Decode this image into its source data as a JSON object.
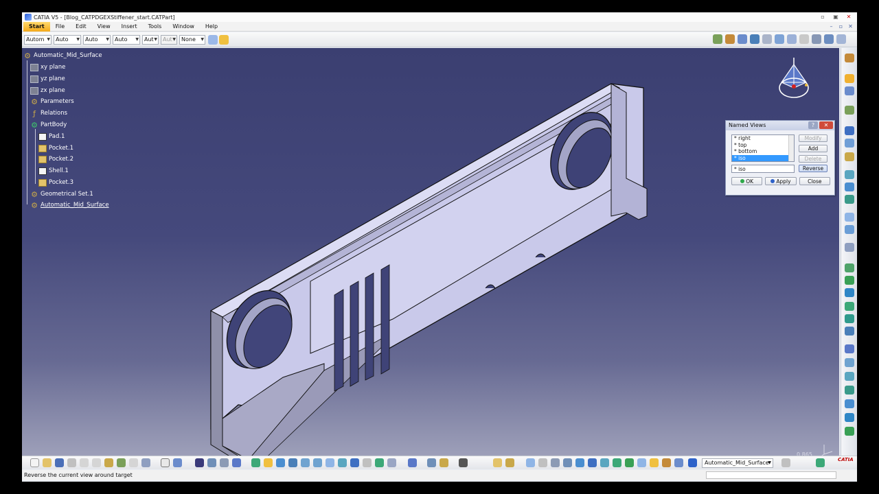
{
  "window": {
    "title": "CATIA V5 - [Blog_CATPDGEXStiffener_start.CATPart]",
    "controls": [
      "▫",
      "▣",
      "✕"
    ]
  },
  "menu": {
    "items": [
      "Start",
      "File",
      "Edit",
      "View",
      "Insert",
      "Tools",
      "Window",
      "Help"
    ],
    "doc_controls": [
      "–",
      "▫",
      "✕"
    ]
  },
  "graphic_properties": {
    "combos": [
      {
        "value": "Autom",
        "disabled": false
      },
      {
        "value": "Auto",
        "disabled": false
      },
      {
        "value": "Auto",
        "disabled": false
      },
      {
        "value": "Auto",
        "disabled": false
      },
      {
        "value": "Aut",
        "disabled": false
      },
      {
        "value": "Aut",
        "disabled": true
      },
      {
        "value": "None",
        "disabled": false
      }
    ]
  },
  "tree": {
    "root": "Automatic_Mid_Surface",
    "nodes": [
      {
        "label": "xy plane",
        "icon": "plane-icon"
      },
      {
        "label": "yz plane",
        "icon": "plane-icon"
      },
      {
        "label": "zx plane",
        "icon": "plane-icon"
      },
      {
        "label": "Parameters",
        "icon": "parameters-icon"
      },
      {
        "label": "Relations",
        "icon": "relations-icon"
      },
      {
        "label": "PartBody",
        "icon": "partbody-icon"
      },
      {
        "label": "Pad.1",
        "icon": "pad-icon"
      },
      {
        "label": "Pocket.1",
        "icon": "pocket-icon"
      },
      {
        "label": "Pocket.2",
        "icon": "pocket-icon"
      },
      {
        "label": "Shell.1",
        "icon": "shell-icon"
      },
      {
        "label": "Pocket.3",
        "icon": "pocket-icon"
      },
      {
        "label": "Geometrical Set.1",
        "icon": "geometrical-set-icon"
      },
      {
        "label": "Automatic_Mid_Surface",
        "icon": "geometrical-set-icon"
      }
    ]
  },
  "named_views": {
    "title": "Named Views",
    "views": [
      "* right",
      "* top",
      "* bottom",
      "* iso"
    ],
    "selected_index": 3,
    "name_value": "* iso",
    "buttons": {
      "modify": "Modify",
      "add": "Add",
      "delete": "Delete",
      "reverse": "Reverse",
      "ok": "OK",
      "apply": "Apply",
      "close": "Close"
    }
  },
  "viewport": {
    "scale": "0.865"
  },
  "bottom_toolbar": {
    "current_set": "Automatic_Mid_Surface"
  },
  "status": {
    "message": "Reverse the current view around target"
  },
  "logo": "CATIA",
  "colors": {
    "part_face": "#cdcdec",
    "part_side": "#8f90a9",
    "viewport_top": "#3b3f71",
    "selection": "#3399ff",
    "start_menu": "#f3a91b"
  }
}
